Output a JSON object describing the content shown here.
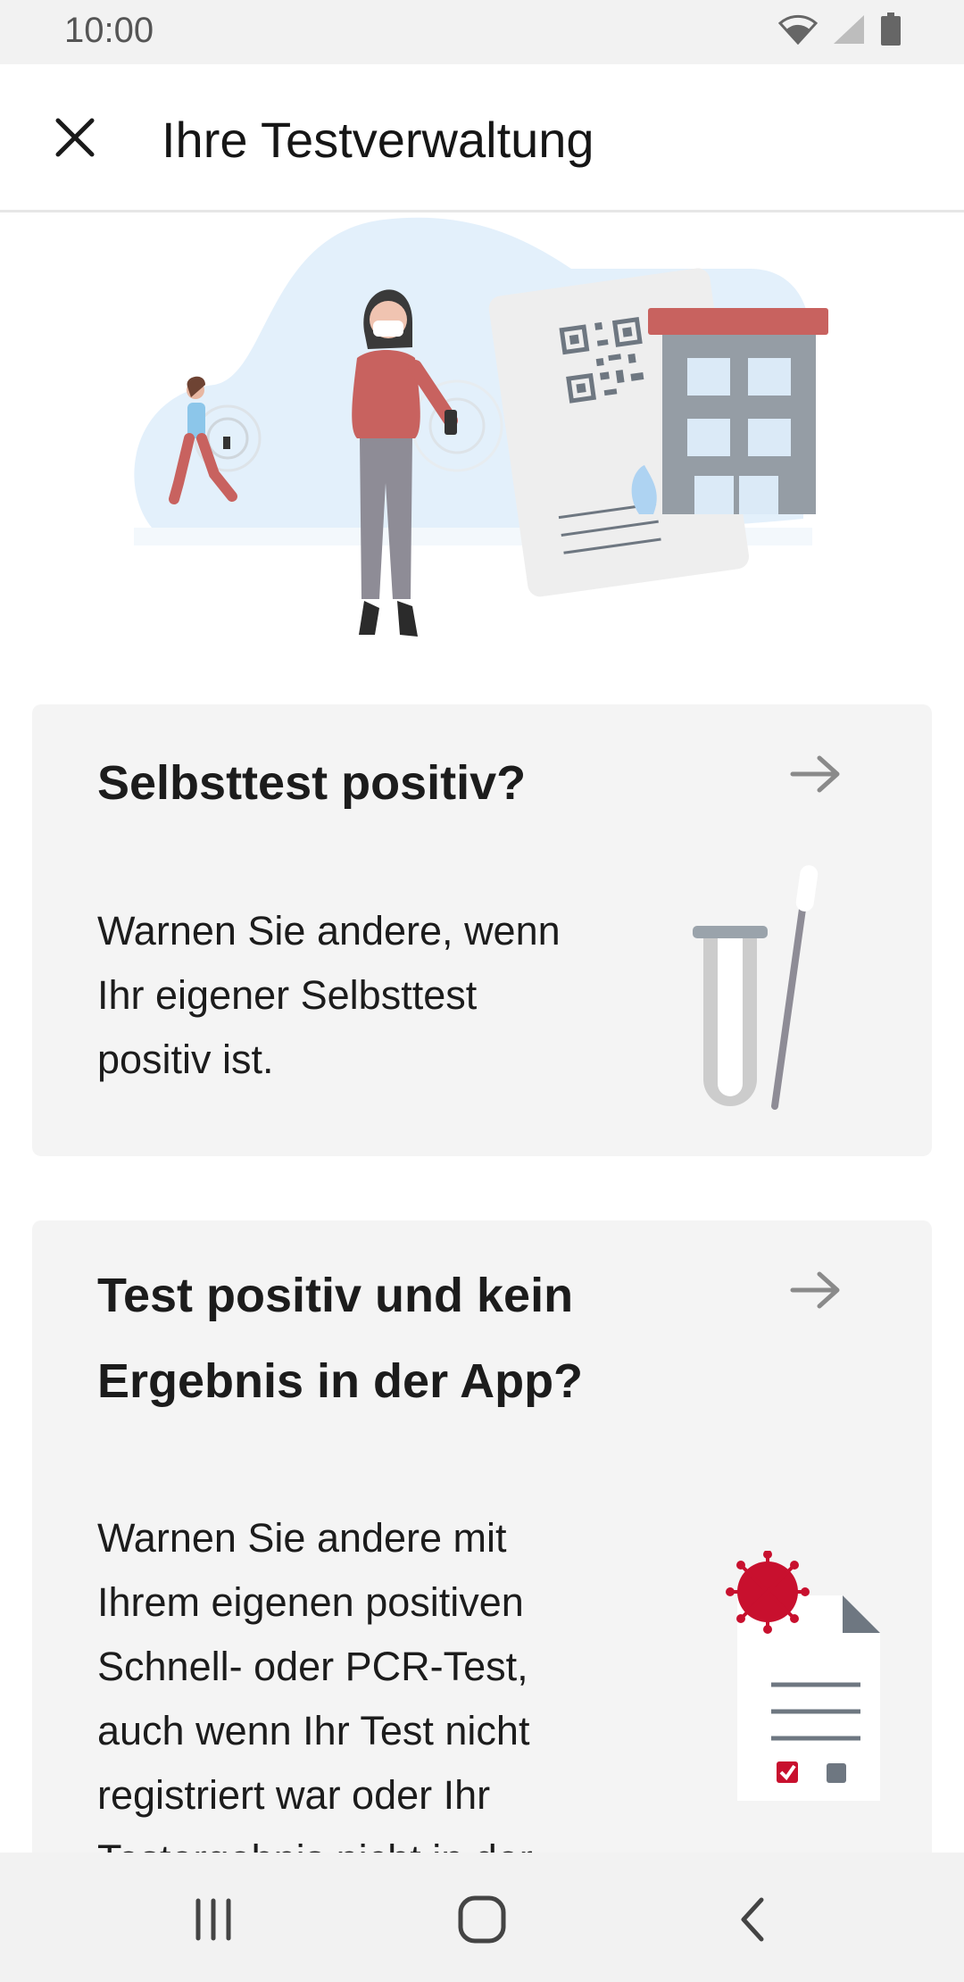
{
  "status": {
    "time": "10:00"
  },
  "header": {
    "title": "Ihre Testverwaltung"
  },
  "cards": [
    {
      "title": "Selbsttest positiv?",
      "lines": [
        "Warnen Sie andere, wenn",
        "Ihr eigener Selbsttest",
        "positiv ist."
      ]
    },
    {
      "title_lines": [
        "Test positiv und kein",
        "Ergebnis in der App?"
      ],
      "lines": [
        "Warnen Sie andere mit",
        "Ihrem eigenen positiven",
        "Schnell- oder PCR-Test,",
        "auch wenn Ihr Test nicht",
        "registriert war oder Ihr",
        "Testergebnis nicht in der"
      ]
    }
  ],
  "colors": {
    "accent_red": "#c8102e",
    "arrow_gray": "#8a8a8a",
    "card_bg": "#f4f4f4"
  },
  "icons": {
    "close": "close-icon",
    "arrow": "arrow-right-icon",
    "nav": [
      "recents-icon",
      "home-icon",
      "back-icon"
    ]
  }
}
